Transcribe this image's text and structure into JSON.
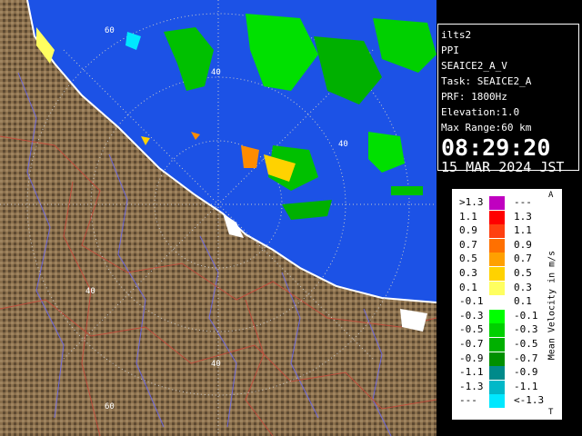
{
  "station": {
    "name": "ilts2",
    "mode": "PPI",
    "product": "SEAICE2_A_V",
    "task": "Task: SEAICE2_A",
    "prf": "PRF: 1800Hz",
    "elevation": "Elevation:1.0",
    "max_range": "Max Range:60 km",
    "time": "08:29:20",
    "date": "15 MAR 2024 JST"
  },
  "map": {
    "range_ring_labels": [
      "60",
      "40",
      "40",
      "40",
      "40",
      "60"
    ],
    "colors": {
      "sea": "#1c52e6",
      "land": "#8a6f4c"
    }
  },
  "legend": {
    "title": "Mean Velocity in m/s",
    "top_mark": "A",
    "bottom_mark": "T",
    "rows": [
      {
        "left": ">1.3",
        "right": "---",
        "color": "#c000c0"
      },
      {
        "left": "1.1",
        "right": "1.3",
        "color": "#ff0000"
      },
      {
        "left": "0.9",
        "right": "1.1",
        "color": "#ff4010"
      },
      {
        "left": "0.7",
        "right": "0.9",
        "color": "#ff7000"
      },
      {
        "left": "0.5",
        "right": "0.7",
        "color": "#ffa000"
      },
      {
        "left": "0.3",
        "right": "0.5",
        "color": "#ffd200"
      },
      {
        "left": "0.1",
        "right": "0.3",
        "color": "#ffff60"
      },
      {
        "left": "-0.1",
        "right": "0.1",
        "color": "#ffffff"
      },
      {
        "left": "-0.3",
        "right": "-0.1",
        "color": "#00ff00"
      },
      {
        "left": "-0.5",
        "right": "-0.3",
        "color": "#00d000"
      },
      {
        "left": "-0.7",
        "right": "-0.5",
        "color": "#00b000"
      },
      {
        "left": "-0.9",
        "right": "-0.7",
        "color": "#009000"
      },
      {
        "left": "-1.1",
        "right": "-0.9",
        "color": "#008a8a"
      },
      {
        "left": "-1.3",
        "right": "-1.1",
        "color": "#00b8c8"
      },
      {
        "left": "---",
        "right": "<-1.3",
        "color": "#00e8ff"
      }
    ]
  }
}
